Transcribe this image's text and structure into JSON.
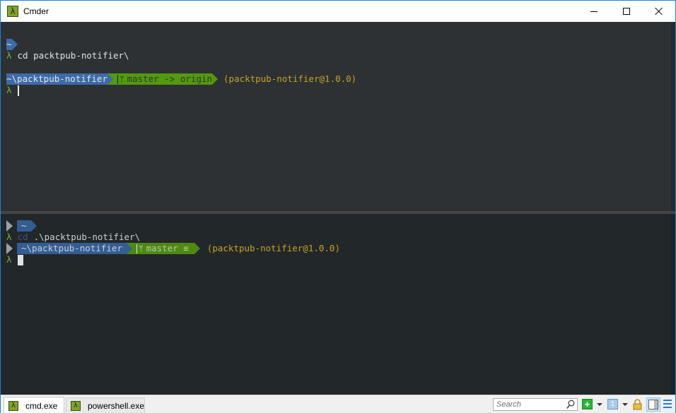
{
  "window": {
    "title": "Cmder",
    "app_icon_glyph": "λ",
    "controls": {
      "minimize": "minimize-icon",
      "maximize": "maximize-icon",
      "close": "close-icon"
    }
  },
  "top_console": {
    "lines": [
      {
        "type": "prompt_segment",
        "path": "~"
      },
      {
        "type": "command",
        "lambda": "λ",
        "text": "cd packtpub-notifier\\"
      },
      {
        "type": "prompt",
        "path": "~\\packtpub-notifier",
        "branch_icon": "ᛘ",
        "git": "master -> origin",
        "package": "(packtpub-notifier@1.0.0)"
      },
      {
        "type": "input",
        "lambda": "λ",
        "value": ""
      }
    ]
  },
  "bottom_console": {
    "lines": [
      {
        "type": "prompt_segment",
        "path": "~"
      },
      {
        "type": "command",
        "lambda": "λ",
        "cmd": "cd",
        "text": ".\\packtpub-notifier\\"
      },
      {
        "type": "prompt",
        "path": "~\\packtpub-notifier",
        "branch_icon": "ᛘ",
        "git": "master ≡",
        "package": "(packtpub-notifier@1.0.0)"
      },
      {
        "type": "input",
        "lambda": "λ",
        "value": ""
      }
    ]
  },
  "tabs": [
    {
      "label": "cmd.exe",
      "icon": "λ",
      "active": true
    },
    {
      "label": "powershell.exe",
      "icon": "λ",
      "active": false
    }
  ],
  "toolbar": {
    "search_placeholder": "Search",
    "new_console": "+",
    "console_number": "1"
  },
  "colors": {
    "accent_border": "#1883d7",
    "segment_blue": "#3d6ba8",
    "segment_green": "#539a0c",
    "lambda_green": "#7fb52f",
    "package_yellow": "#c8a226"
  }
}
